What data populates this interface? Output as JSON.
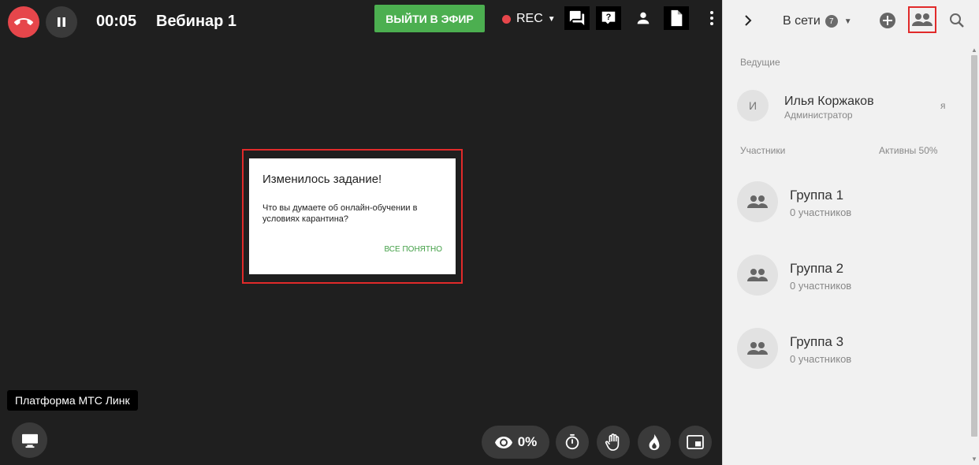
{
  "header": {
    "timer": "00:05",
    "title": "Вебинар 1",
    "go_live_label": "ВЫЙТИ В ЭФИР",
    "rec_label": "REC"
  },
  "modal": {
    "title": "Изменилось задание!",
    "text": "Что вы думаете об онлайн-обучении в условиях карантина?",
    "ok_label": "ВСЕ ПОНЯТНО"
  },
  "tooltip": "Платформа МТС Линк",
  "bottom": {
    "views_percent": "0%"
  },
  "sidebar": {
    "online_label": "В сети",
    "online_count": "7",
    "hosts_label": "Ведущие",
    "host": {
      "initial": "И",
      "name": "Илья Коржаков",
      "role": "Администратор",
      "me_label": "я"
    },
    "participants_label": "Участники",
    "active_label": "Активны 50%",
    "groups": [
      {
        "name": "Группа 1",
        "count": "0 участников"
      },
      {
        "name": "Группа 2",
        "count": "0 участников"
      },
      {
        "name": "Группа 3",
        "count": "0 участников"
      }
    ]
  },
  "colors": {
    "accent_green": "#4caf50",
    "danger_red": "#e6464b",
    "highlight_red": "#e12a2a",
    "dark_bg": "#1f1f1f",
    "panel_bg": "#f1f1f1"
  },
  "icons": [
    "hang-up-icon",
    "pause-icon",
    "chat-icon",
    "question-icon",
    "person-icon",
    "document-icon",
    "more-vert-icon",
    "monitor-icon",
    "eye-icon",
    "stopwatch-icon",
    "hand-icon",
    "fire-icon",
    "picture-in-picture-icon",
    "chevron-right-icon",
    "add-circle-icon",
    "people-icon",
    "search-icon"
  ]
}
